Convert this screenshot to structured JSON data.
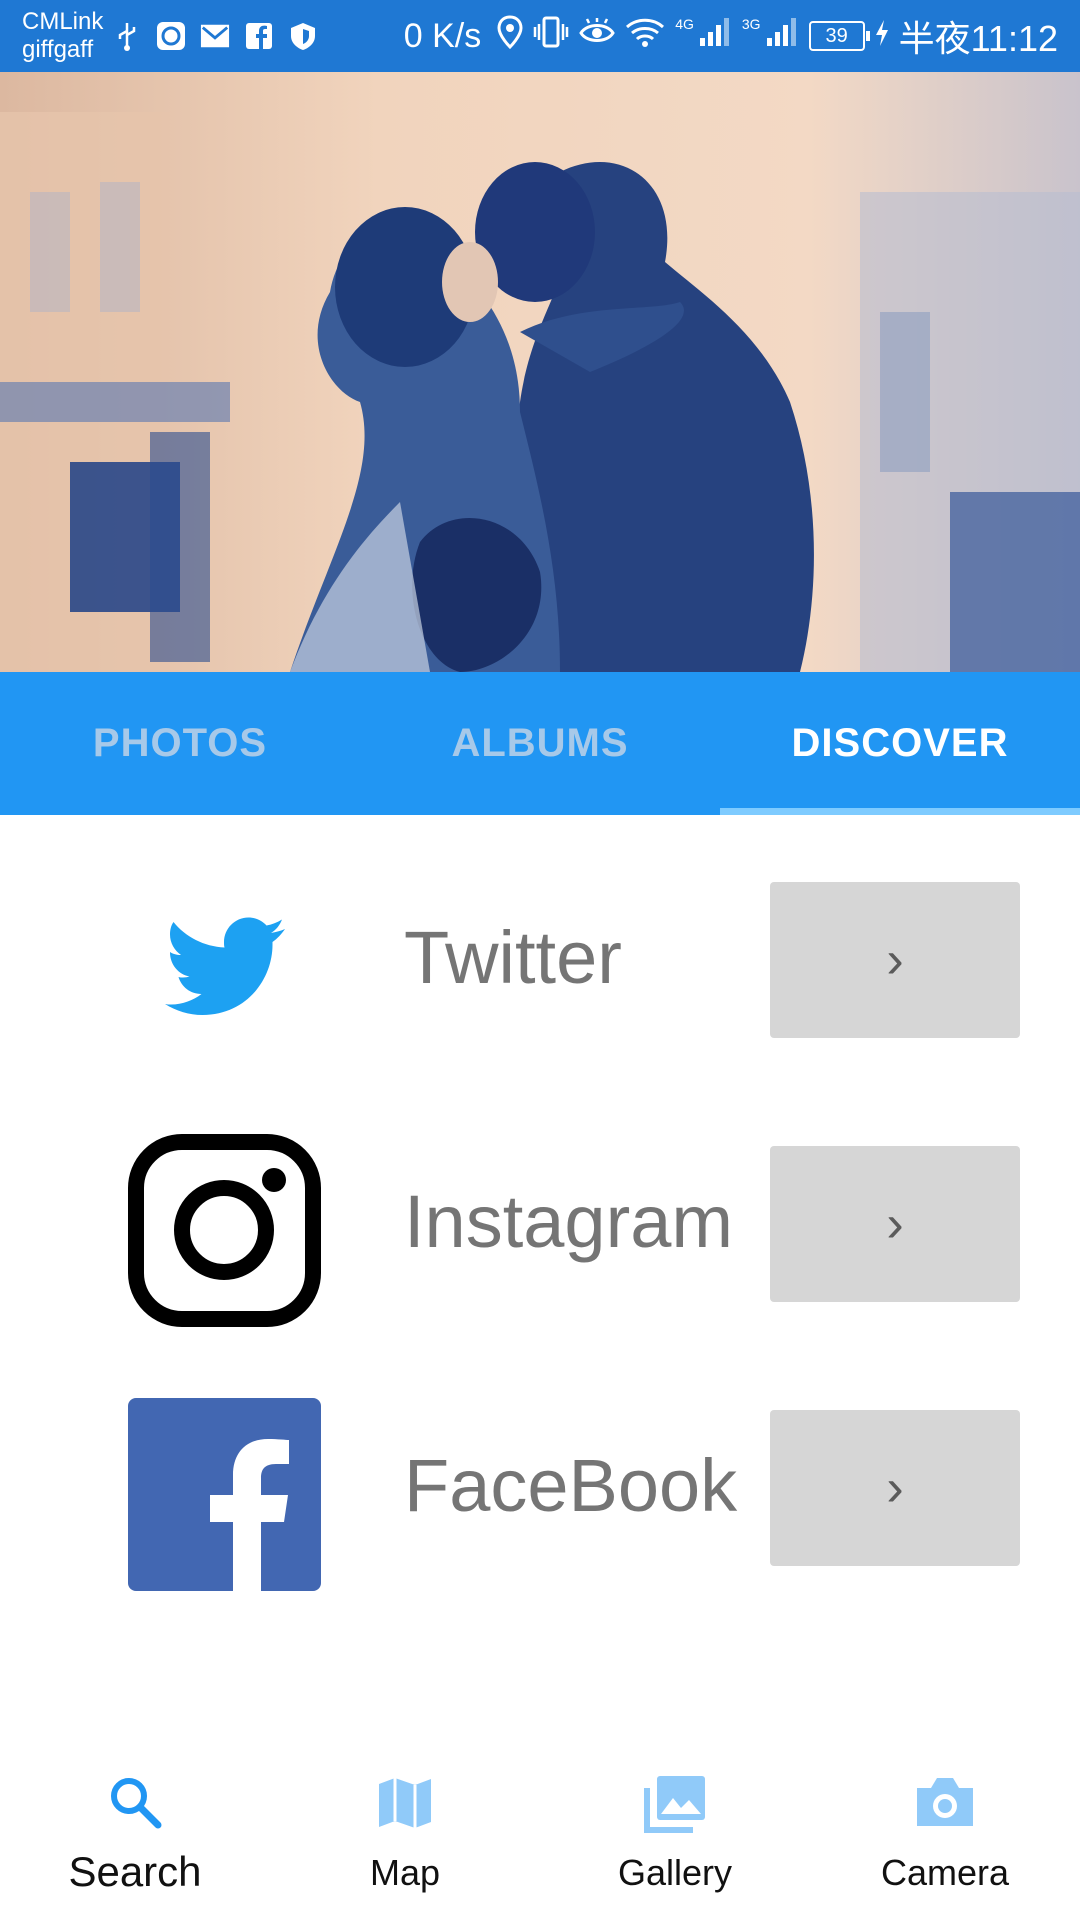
{
  "status_bar": {
    "carrier_line1": "CMLink",
    "carrier_line2": "giffgaff",
    "speed": "0 K/s",
    "net_4g": "4G",
    "net_3g": "3G",
    "battery": "39",
    "time": "半夜11:12"
  },
  "tabs": [
    {
      "label": "PHOTOS",
      "active": false
    },
    {
      "label": "ALBUMS",
      "active": false
    },
    {
      "label": "DISCOVER",
      "active": true
    }
  ],
  "discover_items": [
    {
      "label": "Twitter",
      "icon": "twitter-icon",
      "arrow": "›"
    },
    {
      "label": "Instagram",
      "icon": "instagram-icon",
      "arrow": "›"
    },
    {
      "label": "FaceBook",
      "icon": "facebook-icon",
      "arrow": "›"
    }
  ],
  "bottom_nav": [
    {
      "label": "Search",
      "icon": "search-icon",
      "active": true
    },
    {
      "label": "Map",
      "icon": "map-icon",
      "active": false
    },
    {
      "label": "Gallery",
      "icon": "gallery-icon",
      "active": false
    },
    {
      "label": "Camera",
      "icon": "camera-icon",
      "active": false
    }
  ],
  "colors": {
    "status_bar": "#1f78d3",
    "tab_bar": "#2196f3",
    "tab_indicator": "#7ecbff",
    "twitter_blue": "#1da1f2",
    "facebook_blue": "#4267b2",
    "arrow_button": "#d6d6d6",
    "nav_icon": "#90caf9",
    "nav_icon_active": "#2196f3"
  }
}
